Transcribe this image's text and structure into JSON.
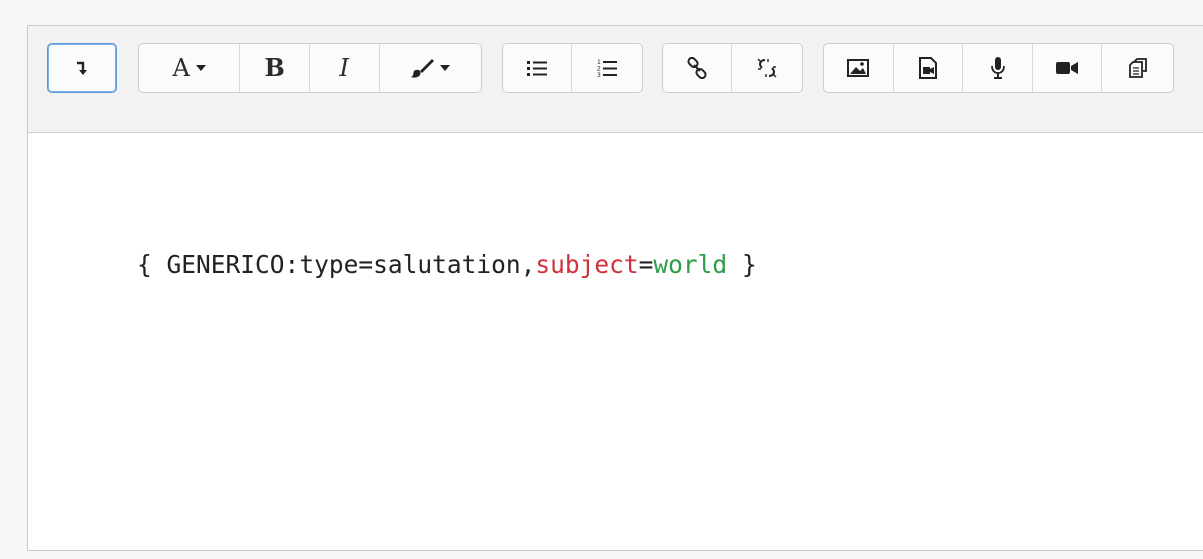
{
  "toolbar": {
    "show_more_icon": "arrow-down-return-icon",
    "font_button_label": "A",
    "bold_label": "B",
    "italic_label": "I",
    "groups": [
      [
        "show-more"
      ],
      [
        "font",
        "bold",
        "italic",
        "color"
      ],
      [
        "bullet-list",
        "numbered-list"
      ],
      [
        "link",
        "unlink"
      ],
      [
        "image",
        "media",
        "record-audio",
        "record-video",
        "manage-files"
      ]
    ]
  },
  "content": {
    "open_brace": "{",
    "filter_name": "GENERICO",
    "colon": ":",
    "key1": "type",
    "eq1": "=",
    "val1": "salutation",
    "comma": ",",
    "key2": "subject",
    "eq2": "=",
    "val2": "world",
    "close_brace": "}"
  },
  "colors": {
    "key_highlight": "#d0323b",
    "value_highlight": "#2e9e46",
    "focus_border": "#5b9bd5"
  }
}
